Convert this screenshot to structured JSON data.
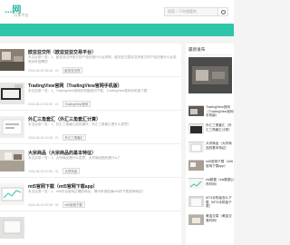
{
  "header": {
    "logo": "...网",
    "logo_sub": "...分享平台",
    "search_placeholder": "搜索一下你想要的"
  },
  "posts": [
    {
      "title": "欧亚亚交所（欧亚亚亚交易平台）",
      "desc": "本文目录一览：1、欧亚亚交所官方的产品在做什么业务呢，欧亚亚交易亚交所官方的产品在做什么业务呢对外招聘的",
      "date": "2024-08-02 08:08",
      "views": "20",
      "tag": "欧亚亚交所"
    },
    {
      "title": "TradingView官网（TradingView官网手机版）",
      "desc": "本文目录一览：1、TradingView官网手机版如何下载，TradingView官网手机版下载",
      "date": "2024-08-02 06:08",
      "views": "21",
      "tag": "TradingView官网"
    },
    {
      "title": "外汇三角套汇（外汇三角套汇计算）",
      "desc": "本文目录一览：1、外汇三角套汇如何操作，外汇三角套汇是什么意思？",
      "date": "2024-08-02 04:08",
      "views": "21",
      "tag": "外汇三角套汇"
    },
    {
      "title": "大宗商品（大宗商品的基本特征）",
      "desc": "本文目录一览：1、大宗商品是什么意思，大宗商品指的是什么？",
      "date": "2024-08-02 02:08",
      "views": "31",
      "tag": "大宗商品"
    },
    {
      "title": "mt5官网下载（mt5官网下载app）",
      "desc": "本文目录一览：1、mt5平台官网正确的网址，请问有谁知道mt5的下载官网地址？",
      "date": "2024-08-02 00:08",
      "views": "30",
      "tag": "mt5官网下载"
    }
  ],
  "sidebar": {
    "title": "最新发布",
    "items": [
      "TradingView官网（TradingView官网手机版）",
      "外汇三角套汇（外汇三角套汇计算）",
      "大宗商品（大宗商品的基本特征）",
      "mt5官网下载（mt5官网下载app）",
      "eia数据（eia数据公布时间）",
      "MT4手机版怎么下载（MT4手机版下载）",
      "黄金交易（黄金交易时间）"
    ]
  },
  "colors": {
    "brand": "#2fc5a9",
    "page_bg": "#f4f4f4",
    "card_bg": "#ffffff"
  }
}
